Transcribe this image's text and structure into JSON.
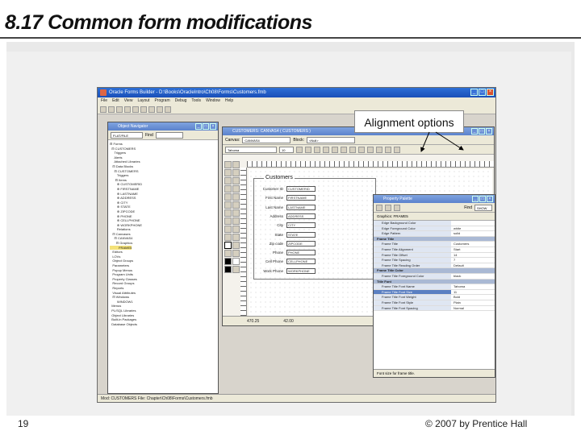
{
  "slide": {
    "title": "8.17 Common form modifications",
    "page_number": "19",
    "copyright": "© 2007 by Prentice Hall"
  },
  "callout": {
    "text": "Alignment options"
  },
  "app": {
    "title": "Oracle Forms Builder - D:\\Books\\OracleIntro\\Ch08\\Forms\\Customers.fmb",
    "menu": [
      "File",
      "Edit",
      "View",
      "Layout",
      "Program",
      "Debug",
      "Tools",
      "Window",
      "Help"
    ],
    "status": "Mod: CUSTOMERS  File: Chapter\\Ch08\\Forms\\Customers.fmb"
  },
  "navigator": {
    "title": "Object Navigator",
    "combo_value": "FLAT/FILE",
    "find_label": "Find",
    "tree": [
      "⊟ Forms",
      "  ⊟ CUSTOMERS",
      "     Triggers",
      "     Alerts",
      "     Attached Libraries",
      "   ⊟ Data Blocks",
      "     ⊟ CUSTOMERS",
      "        Triggers",
      "      ⊟ Items",
      "        ⊕ CUSTOMERID",
      "        ⊕ FIRSTNAME",
      "        ⊕ LASTNAME",
      "        ⊕ ADDRESS",
      "        ⊕ CITY",
      "        ⊕ STATE",
      "        ⊕ ZIPCODE",
      "        ⊕ PHONE",
      "        ⊕ CELLPHONE",
      "        ⊕ WORKPHONE",
      "        Relations",
      "   ⊟ Canvases",
      "     ⊟ CANVAS4",
      "       ⊟ Graphics",
      "          FRAME5",
      "   Editors",
      "   LOVs",
      "   Object Groups",
      "   Parameters",
      "   Popup Menus",
      "   Program Units",
      "   Property Classes",
      "   Record Groups",
      "   Reports",
      "   Visual Attributes",
      "   ⊟ Windows",
      "        WINDOW1",
      "  Menus",
      "  PL/SQL Libraries",
      "  Object Libraries",
      "  Built-in Packages",
      "  Database Objects"
    ]
  },
  "canvas": {
    "title": "CUSTOMERS: CANVAS4 ( CUSTOMERS )",
    "canvas_combo": "CANVAS4",
    "block_label": "Block:",
    "block_combo": "<Null>",
    "font_combo": "Tahoma",
    "size_combo": "10",
    "frame_title": "Customers",
    "fields": [
      {
        "label": "Customer ID",
        "value": "CUSTOMERID"
      },
      {
        "label": "First Name",
        "value": "FIRSTNAME"
      },
      {
        "label": "Last Name",
        "value": "LASTNAME"
      },
      {
        "label": "Address",
        "value": "ADDRESS"
      },
      {
        "label": "City",
        "value": "CITY"
      },
      {
        "label": "State",
        "value": "STATE"
      },
      {
        "label": "Zip code",
        "value": "ZIPCODE"
      },
      {
        "label": "Phone",
        "value": "PHONE"
      },
      {
        "label": "Cell Phone",
        "value": "CELLPHONE"
      },
      {
        "label": "Work Phone",
        "value": "WORKPHONE"
      }
    ],
    "status_pos": "470.25",
    "status_size": "42.00"
  },
  "palette": {
    "title": "Property Palette",
    "find_label": "Find",
    "find_value": "SHOW",
    "header": "Graphics: FRAME5",
    "rows": [
      {
        "name": "Edge Background Color",
        "value": "",
        "type": "prop"
      },
      {
        "name": "Edge Foreground Color",
        "value": "white",
        "type": "prop"
      },
      {
        "name": "Edge Pattern",
        "value": "solid",
        "type": "prop"
      },
      {
        "name": "Frame Title",
        "value": "",
        "type": "group"
      },
      {
        "name": "Frame Title",
        "value": "Customers",
        "type": "prop"
      },
      {
        "name": "Frame Title Alignment",
        "value": "Start",
        "type": "prop"
      },
      {
        "name": "Frame Title Offset",
        "value": "14",
        "type": "prop"
      },
      {
        "name": "Frame Title Spacing",
        "value": "7",
        "type": "prop"
      },
      {
        "name": "Frame Title Reading Order",
        "value": "Default",
        "type": "prop"
      },
      {
        "name": "Frame Title Color",
        "value": "",
        "type": "group"
      },
      {
        "name": "Frame Title Foreground Color",
        "value": "black",
        "type": "prop"
      },
      {
        "name": "Title Font",
        "value": "",
        "type": "group"
      },
      {
        "name": "Frame Title Font Name",
        "value": "Tahoma",
        "type": "prop"
      },
      {
        "name": "Frame Title Font Size",
        "value": "11",
        "type": "hl"
      },
      {
        "name": "Frame Title Font Weight",
        "value": "Bold",
        "type": "prop"
      },
      {
        "name": "Frame Title Font Style",
        "value": "Plain",
        "type": "prop"
      },
      {
        "name": "Frame Title Font Spacing",
        "value": "Normal",
        "type": "prop"
      }
    ],
    "footer": "Font size for frame title."
  }
}
